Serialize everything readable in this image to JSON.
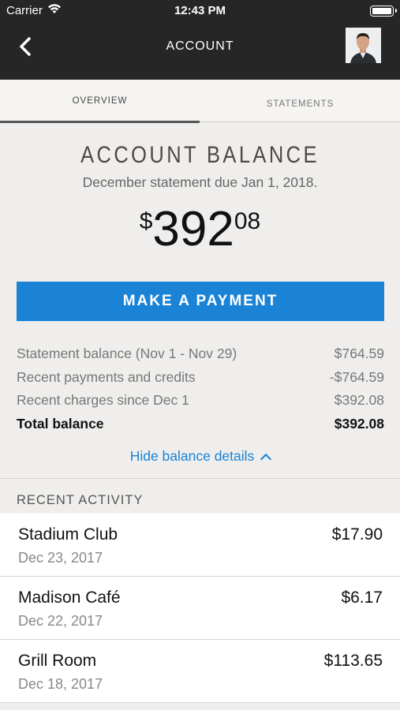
{
  "status_bar": {
    "carrier": "Carrier",
    "time": "12:43 PM"
  },
  "nav": {
    "title": "ACCOUNT",
    "back_icon": "chevron-left-icon",
    "avatar": "user-avatar"
  },
  "tabs": [
    {
      "label": "OVERVIEW",
      "active": true
    },
    {
      "label": "STATEMENTS",
      "active": false
    }
  ],
  "balance": {
    "title": "ACCOUNT BALANCE",
    "subtitle": "December statement due Jan 1, 2018.",
    "currency": "$",
    "dollars": "392",
    "cents": "08"
  },
  "payment_button": {
    "label": "MAKE A PAYMENT"
  },
  "details": [
    {
      "label": "Statement balance (Nov 1 - Nov 29)",
      "value": "$764.59"
    },
    {
      "label": "Recent payments and credits",
      "value": "-$764.59"
    },
    {
      "label": "Recent charges since Dec 1",
      "value": "$392.08"
    },
    {
      "label": "Total balance",
      "value": "$392.08"
    }
  ],
  "hide_details": {
    "label": "Hide balance details"
  },
  "recent_activity": {
    "header": "RECENT ACTIVITY",
    "items": [
      {
        "name": "Stadium Club",
        "date": "Dec 23, 2017",
        "amount": "$17.90"
      },
      {
        "name": "Madison Café",
        "date": "Dec 22, 2017",
        "amount": "$6.17"
      },
      {
        "name": "Grill Room",
        "date": "Dec 18, 2017",
        "amount": "$113.65"
      }
    ]
  },
  "colors": {
    "accent": "#1a83d6",
    "nav_bg": "#262626",
    "page_bg": "#efeeec"
  }
}
